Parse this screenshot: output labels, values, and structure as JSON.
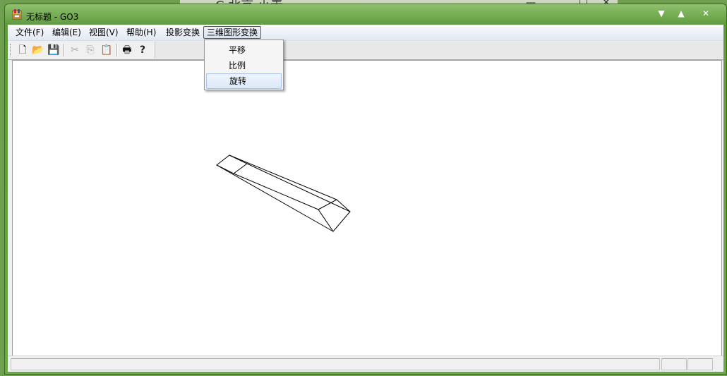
{
  "window": {
    "title": "无标题 - GO3",
    "controls": {
      "minimize": "▼",
      "maximize": "▲",
      "close": "✕"
    }
  },
  "background_window": {
    "title": "C  北京 小青",
    "controls": [
      "—",
      "□",
      "✕"
    ]
  },
  "menubar": {
    "items": [
      {
        "label": "文件(F)"
      },
      {
        "label": "编辑(E)"
      },
      {
        "label": "视图(V)"
      },
      {
        "label": "帮助(H)"
      },
      {
        "label": "投影变换"
      },
      {
        "label": "三维图形变换",
        "active": true
      }
    ]
  },
  "dropdown": {
    "items": [
      {
        "label": "平移"
      },
      {
        "label": "比例"
      },
      {
        "label": "旋转",
        "highlighted": true
      }
    ]
  },
  "toolbar": {
    "buttons": [
      {
        "name": "new-file-icon",
        "glyph": "🗋",
        "enabled": true
      },
      {
        "name": "open-folder-icon",
        "glyph": "📂",
        "enabled": true
      },
      {
        "name": "save-disk-icon",
        "glyph": "💾",
        "enabled": true
      },
      {
        "name": "cut-icon",
        "glyph": "✂",
        "enabled": false
      },
      {
        "name": "copy-icon",
        "glyph": "⎘",
        "enabled": false
      },
      {
        "name": "paste-icon",
        "glyph": "📋",
        "enabled": false
      },
      {
        "name": "print-icon",
        "glyph": "🖶",
        "enabled": true
      },
      {
        "name": "help-icon",
        "glyph": "?",
        "enabled": true
      }
    ]
  },
  "colors": {
    "frame": "#6aa84a",
    "menu_highlight": "#dde9f8",
    "canvas": "#ffffff"
  }
}
